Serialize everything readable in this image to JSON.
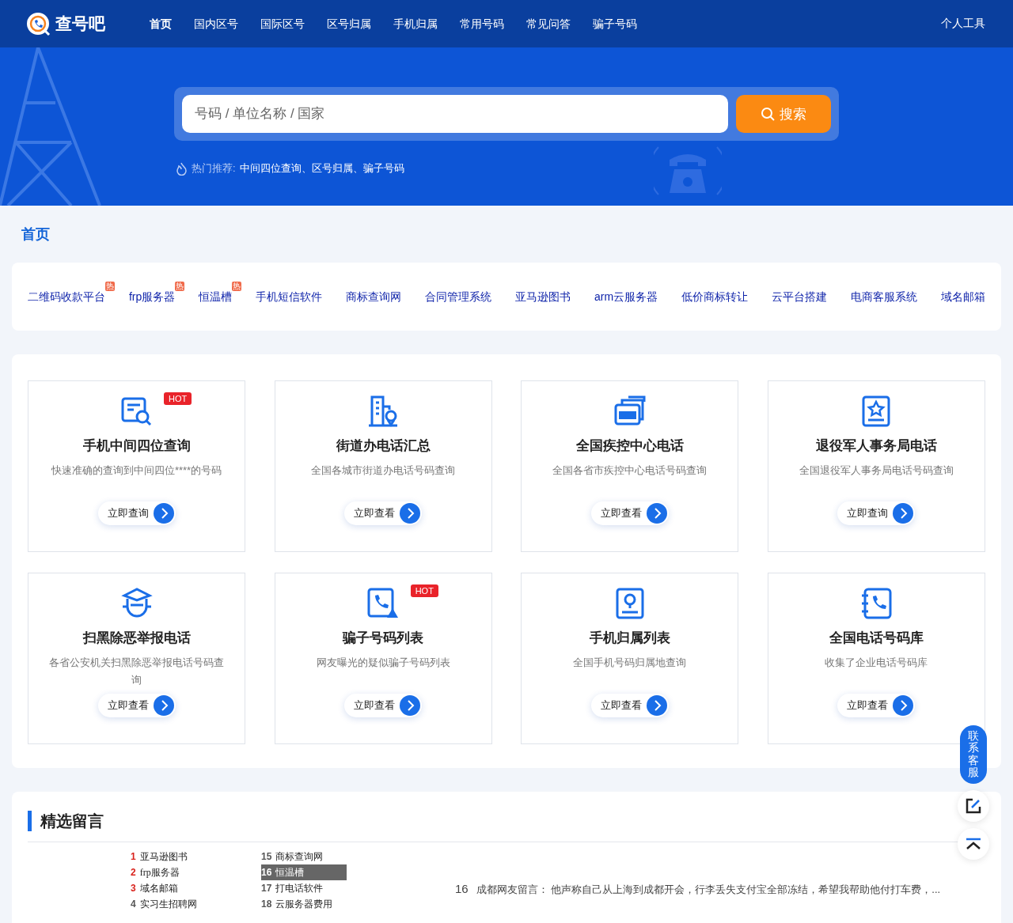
{
  "header": {
    "logo": "查号吧",
    "nav": [
      {
        "label": "首页",
        "selected": true
      },
      {
        "label": "国内区号",
        "selected": false
      },
      {
        "label": "国际区号",
        "selected": false
      },
      {
        "label": "区号归属",
        "selected": false
      },
      {
        "label": "手机归属",
        "selected": false
      },
      {
        "label": "常用号码",
        "selected": false
      },
      {
        "label": "常见问答",
        "selected": false
      },
      {
        "label": "骗子号码",
        "selected": false
      }
    ],
    "tools": "个人工具"
  },
  "search": {
    "placeholder": "号码 / 单位名称 / 国家",
    "button": "搜索",
    "hot_label": "热门推荐:",
    "hot_links": "中间四位查询、区号归属、骗子号码"
  },
  "breadcrumb": "首页",
  "links": [
    {
      "label": "二维码收款平台",
      "badge": "热"
    },
    {
      "label": "frp服务器",
      "badge": "热"
    },
    {
      "label": "恒温槽",
      "badge": "热"
    },
    {
      "label": "手机短信软件"
    },
    {
      "label": "商标查询网"
    },
    {
      "label": "合同管理系统"
    },
    {
      "label": "亚马逊图书"
    },
    {
      "label": "arm云服务器"
    },
    {
      "label": "低价商标转让"
    },
    {
      "label": "云平台搭建"
    },
    {
      "label": "电商客服系统"
    },
    {
      "label": "域名邮箱"
    }
  ],
  "services": [
    {
      "kind": "search",
      "title": "手机中间四位查询",
      "desc": "快速准确的查询到中间四位****的号码",
      "button": "立即查询",
      "badge": "HOT"
    },
    {
      "kind": "building",
      "title": "街道办电话汇总",
      "desc": "全国各城市街道办电话号码查询",
      "button": "立即查看"
    },
    {
      "kind": "cdc",
      "title": "全国疾控中心电话",
      "desc": "全国各省市疾控中心电话号码查询",
      "button": "立即查看"
    },
    {
      "kind": "star",
      "title": "退役军人事务局电话",
      "desc": "全国退役军人事务局电话号码查询",
      "button": "立即查询"
    },
    {
      "kind": "police",
      "title": "扫黑除恶举报电话",
      "desc": "各省公安机关扫黑除恶举报电话号码查询",
      "button": "立即查看"
    },
    {
      "kind": "alert",
      "title": "骗子号码列表",
      "desc": "网友曝光的疑似骗子号码列表",
      "button": "立即查看",
      "badge": "HOT"
    },
    {
      "kind": "location",
      "title": "手机归属列表",
      "desc": "全国手机号码归属地查询",
      "button": "立即查看"
    },
    {
      "kind": "book",
      "title": "全国电话号码库",
      "desc": "收集了企业电话号码库",
      "button": "立即查看"
    }
  ],
  "messages": {
    "title": "精选留言",
    "rank_left": [
      {
        "num": "1",
        "text": "亚马逊图书",
        "color": "#d9231d",
        "selected": false
      },
      {
        "num": "2",
        "text": "frp服务器",
        "color": "#d9231d",
        "selected": false
      },
      {
        "num": "3",
        "text": "域名邮箱",
        "color": "#d9231d",
        "selected": false
      },
      {
        "num": "4",
        "text": "实习生招聘网",
        "color": "#555555",
        "selected": false
      }
    ],
    "rank_right": [
      {
        "num": "15",
        "text": "商标查询网",
        "color": "#555555",
        "selected": false
      },
      {
        "num": "16",
        "text": "恒温槽",
        "color": "#ffffff",
        "selected": true
      },
      {
        "num": "17",
        "text": "打电话软件",
        "color": "#555555",
        "selected": false
      },
      {
        "num": "18",
        "text": "云服务器费用",
        "color": "#555555",
        "selected": false
      }
    ],
    "item": {
      "num": "16",
      "text": "成都网友留言： 他声称自己从上海到成都开会，行李丢失支付宝全部冻结，希望我帮助他付打车费，..."
    }
  },
  "float": {
    "contact": "联系客服"
  }
}
